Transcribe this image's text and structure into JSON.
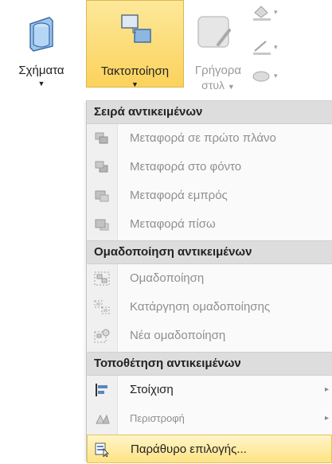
{
  "ribbon": {
    "shapes_label": "Σχήματα",
    "arrange_label": "Τακτοποίηση",
    "quick_label_1": "Γρήγορα",
    "quick_label_2": "στυλ",
    "caret": "▼"
  },
  "menu": {
    "sections": [
      {
        "header": "Σειρά αντικειμένων",
        "items": [
          {
            "label": "Μεταφορά σε πρώτο πλάνο",
            "icon": "bring-to-front-icon",
            "enabled": false
          },
          {
            "label": "Μεταφορά στο φόντο",
            "icon": "send-to-back-icon",
            "enabled": false
          },
          {
            "label": "Μεταφορά εμπρός",
            "icon": "bring-forward-icon",
            "enabled": false
          },
          {
            "label": "Μεταφορά πίσω",
            "icon": "send-backward-icon",
            "enabled": false
          }
        ]
      },
      {
        "header": "Ομαδοποίηση αντικειμένων",
        "items": [
          {
            "label": "Ομαδοποίηση",
            "icon": "group-icon",
            "enabled": false
          },
          {
            "label": "Κατάργηση ομαδοποίησης",
            "icon": "ungroup-icon",
            "enabled": false
          },
          {
            "label": "Νέα ομαδοποίηση",
            "icon": "regroup-icon",
            "enabled": false
          }
        ]
      },
      {
        "header": "Τοποθέτηση αντικειμένων",
        "items": [
          {
            "label": "Στοίχιση",
            "icon": "align-icon",
            "enabled": true,
            "submenu": true
          },
          {
            "label": "Περιστροφή",
            "icon": "rotate-icon",
            "enabled": false,
            "submenu": true
          },
          {
            "label": "Παράθυρο επιλογής...",
            "icon": "selection-pane-icon",
            "enabled": true,
            "highlighted": true
          }
        ]
      }
    ],
    "submenu_arrow": "▸"
  }
}
